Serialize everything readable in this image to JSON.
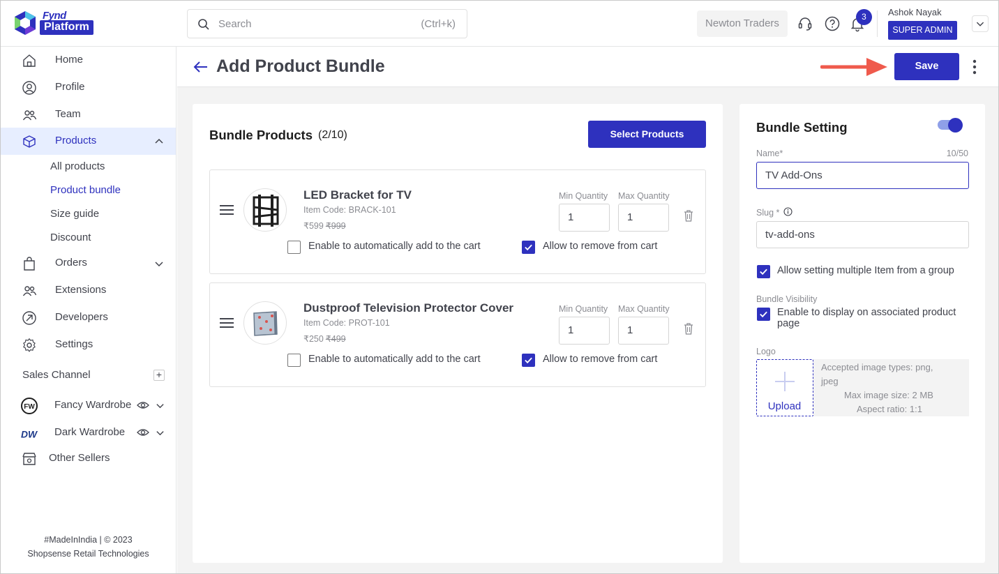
{
  "brand": {
    "line1": "Fynd",
    "line2": "Platform",
    "color": "#2e31be"
  },
  "topbar": {
    "search_placeholder": "Search",
    "search_shortcut": "(Ctrl+k)",
    "company": "Newton Traders",
    "notifications_count": "3",
    "user_name": "Ashok Nayak",
    "user_role": "SUPER ADMIN"
  },
  "sidebar": {
    "items": [
      {
        "label": "Home",
        "icon": "home-icon"
      },
      {
        "label": "Profile",
        "icon": "profile-icon"
      },
      {
        "label": "Team",
        "icon": "team-icon"
      },
      {
        "label": "Products",
        "icon": "box-icon",
        "active": true,
        "expanded": true
      },
      {
        "label": "Orders",
        "icon": "bag-icon"
      },
      {
        "label": "Extensions",
        "icon": "extensions-icon"
      },
      {
        "label": "Developers",
        "icon": "developers-icon"
      },
      {
        "label": "Settings",
        "icon": "gear-icon"
      }
    ],
    "products_sub": [
      "All products",
      "Product bundle",
      "Size guide",
      "Discount"
    ],
    "active_sub": "Product bundle",
    "sales_channel_title": "Sales Channel",
    "sales_channel_add": "+",
    "channels": [
      {
        "label": "Fancy Wardrobe",
        "logo": "FW"
      },
      {
        "label": "Dark Wardrobe",
        "logo": "DW"
      }
    ],
    "other_sellers": "Other Sellers",
    "footer_line1": "#MadeInIndia | © 2023",
    "footer_line2": "Shopsense Retail Technologies"
  },
  "page": {
    "title": "Add Product Bundle",
    "save_label": "Save"
  },
  "bundle_products": {
    "title": "Bundle Products",
    "count": "(2/10)",
    "select_label": "Select Products",
    "min_label": "Min Quantity",
    "max_label": "Max Quantity",
    "auto_add_label": "Enable to automatically add to the cart",
    "allow_remove_label": "Allow to remove from cart",
    "items": [
      {
        "name": "LED Bracket for TV",
        "code": "Item Code: BRACK-101",
        "price": "₹599",
        "mrp": "₹999",
        "min": "1",
        "max": "1",
        "auto_add": false,
        "allow_remove": true
      },
      {
        "name": "Dustproof Television Protector Cover",
        "code": "Item Code: PROT-101",
        "price": "₹250",
        "mrp": "₹499",
        "min": "1",
        "max": "1",
        "auto_add": false,
        "allow_remove": true
      }
    ]
  },
  "bundle_setting": {
    "title": "Bundle Setting",
    "enabled": true,
    "name_label": "Name*",
    "name_count": "10/50",
    "name_value": "TV Add-Ons",
    "slug_label": "Slug *",
    "slug_value": "tv-add-ons",
    "multi_label": "Allow setting multiple Item from a group",
    "multi_checked": true,
    "visibility_label": "Bundle Visibility",
    "visibility_text": "Enable to display on associated product page",
    "visibility_checked": true,
    "logo_label": "Logo",
    "upload_label": "Upload",
    "accepted_types": "Accepted image types: png,",
    "accepted_types_2": "jpeg",
    "max_size": "Max image size: 2 MB",
    "aspect_ratio": "Aspect ratio: 1:1"
  }
}
